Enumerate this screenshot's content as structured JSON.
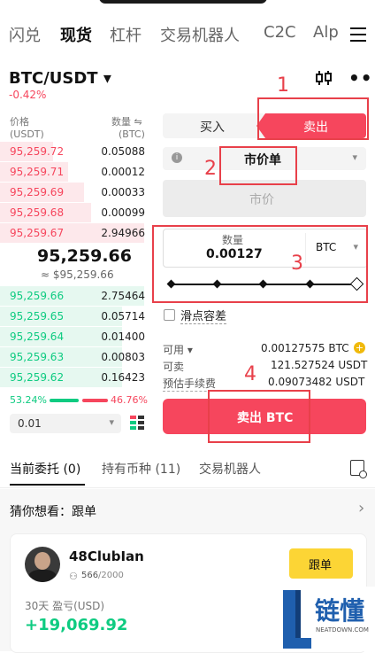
{
  "nav": {
    "tabs": [
      "闪兑",
      "现货",
      "杠杆",
      "交易机器人",
      "C2C",
      "Alp"
    ]
  },
  "pair": {
    "symbol": "BTC/USDT ▾",
    "change": "-0.42%"
  },
  "orderbook": {
    "price_header": "价格",
    "price_unit": "(USDT)",
    "qty_header": "数量 ⇋",
    "qty_unit": "(BTC)",
    "asks": [
      {
        "price": "95,259.72",
        "qty": "0.05088",
        "depth": 0.35
      },
      {
        "price": "95,259.71",
        "qty": "0.00012",
        "depth": 0.45
      },
      {
        "price": "95,259.69",
        "qty": "0.00033",
        "depth": 0.55
      },
      {
        "price": "95,259.68",
        "qty": "0.00099",
        "depth": 0.6
      },
      {
        "price": "95,259.67",
        "qty": "2.94966",
        "depth": 0.95
      }
    ],
    "last_price": "95,259.66",
    "last_price_fiat": "≈ $95,259.66",
    "bids": [
      {
        "price": "95,259.66",
        "qty": "2.75464",
        "depth": 0.95
      },
      {
        "price": "95,259.65",
        "qty": "0.05714",
        "depth": 0.8
      },
      {
        "price": "95,259.64",
        "qty": "0.01400",
        "depth": 0.8
      },
      {
        "price": "95,259.63",
        "qty": "0.00803",
        "depth": 0.8
      },
      {
        "price": "95,259.62",
        "qty": "0.16423",
        "depth": 0.8
      }
    ],
    "buy_ratio": "53.24%",
    "sell_ratio": "46.76%",
    "buy_fraction": 0.5324,
    "precision": "0.01"
  },
  "form": {
    "buy_tab": "买入",
    "sell_tab": "卖出",
    "order_type": "市价单",
    "price_placeholder": "市价",
    "qty_label": "数量",
    "qty_value": "0.00127",
    "qty_unit": "BTC",
    "slippage_label": "滑点容差",
    "available_label": "可用 ▾",
    "available_value": "0.00127575 BTC",
    "sellable_label": "可卖",
    "sellable_value": "121.527524 USDT",
    "fee_label": "预估手续费",
    "fee_value": "0.09073482 USDT",
    "submit": "卖出 BTC"
  },
  "annotations": [
    "1",
    "2",
    "3",
    "4"
  ],
  "bottom_tabs": {
    "orders": "当前委托 (0)",
    "holdings": "持有币种 (11)",
    "bots": "交易机器人"
  },
  "guess": {
    "title": "猜你想看：跟单",
    "arrow": "›"
  },
  "trader": {
    "name": "48ClubIan",
    "followers": "566",
    "followers_max": "/2000",
    "follow_button": "跟单",
    "pnl_label": "30天 盈亏(USD)",
    "pnl_value": "+19,069.92"
  },
  "watermark": {
    "brand": "链懂",
    "url": "NEATDOWN.COM"
  },
  "colors": {
    "red": "#f6465d",
    "green": "#0ecb81",
    "follow": "#fcd535",
    "anno": "#e8404a"
  }
}
